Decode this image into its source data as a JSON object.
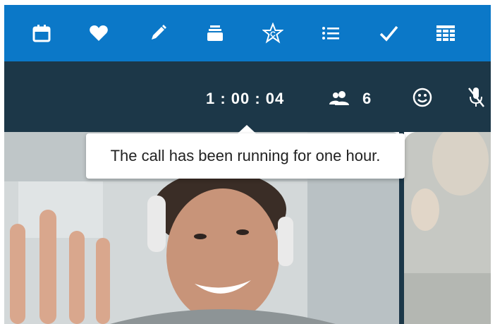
{
  "toolbar": {
    "icons": [
      "calendar-icon",
      "heart-icon",
      "pencil-icon",
      "inbox-stack-icon",
      "star-c-icon",
      "list-icon",
      "checkmark-icon",
      "grid-table-icon"
    ]
  },
  "call": {
    "duration": "1 : 00 : 04",
    "participants": "6",
    "icons": [
      "participants-icon",
      "smiley-icon",
      "mic-muted-icon"
    ]
  },
  "tooltip": {
    "text": "The call has been running for one hour."
  },
  "colors": {
    "toolbar_bg": "#0b78c8",
    "callbar_bg": "#1c3748",
    "tooltip_bg": "#ffffff"
  }
}
